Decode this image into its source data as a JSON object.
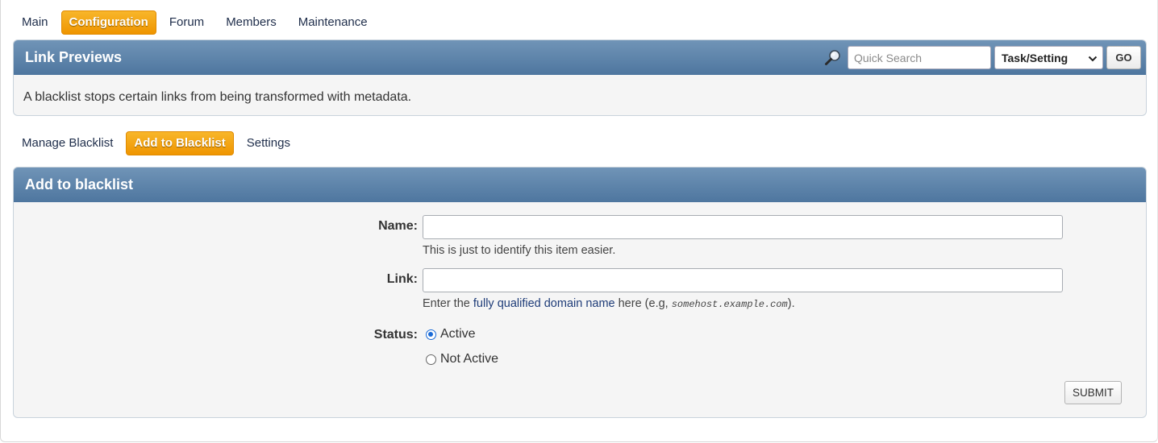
{
  "top_nav": {
    "items": [
      {
        "label": "Main",
        "active": false
      },
      {
        "label": "Configuration",
        "active": true
      },
      {
        "label": "Forum",
        "active": false
      },
      {
        "label": "Members",
        "active": false
      },
      {
        "label": "Maintenance",
        "active": false
      }
    ]
  },
  "header": {
    "title": "Link Previews",
    "description": "A blacklist stops certain links from being transformed with metadata.",
    "search": {
      "icon": "magnifier-icon",
      "placeholder": "Quick Search",
      "value": "",
      "select_value": "Task/Setting",
      "go_label": "GO"
    }
  },
  "sub_nav": {
    "items": [
      {
        "label": "Manage Blacklist",
        "active": false
      },
      {
        "label": "Add to Blacklist",
        "active": true
      },
      {
        "label": "Settings",
        "active": false
      }
    ]
  },
  "form": {
    "title": "Add to blacklist",
    "name_label": "Name:",
    "name_value": "",
    "name_help": "This is just to identify this item easier.",
    "link_label": "Link:",
    "link_value": "",
    "link_help_prefix": "Enter the ",
    "link_help_link": "fully qualified domain name",
    "link_help_middle": " here (e.g, ",
    "link_help_example": "somehost.example.com",
    "link_help_suffix": ").",
    "status_label": "Status:",
    "status_options": [
      {
        "label": "Active",
        "checked": true
      },
      {
        "label": "Not Active",
        "checked": false
      }
    ],
    "submit_label": "SUBMIT"
  },
  "colors": {
    "accent_orange": "#f0a00c",
    "header_blue": "#5a80a8",
    "link_blue": "#1e3c78",
    "radio_blue": "#1a6ad6"
  }
}
